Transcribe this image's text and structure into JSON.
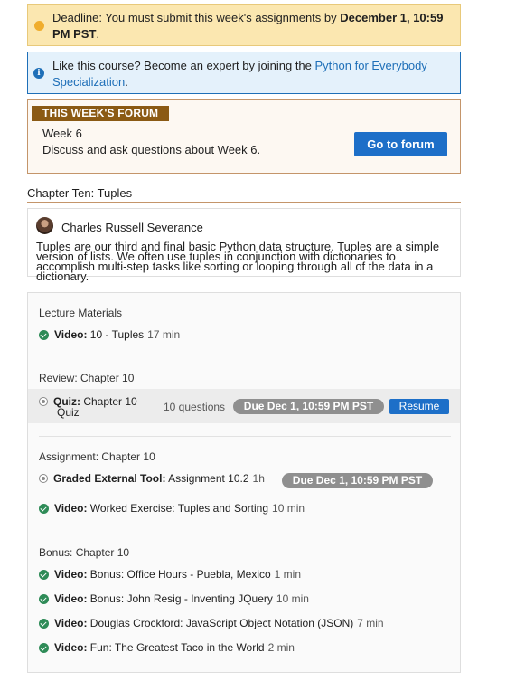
{
  "deadline": {
    "prefix": "Deadline: You must submit this week's assignments by ",
    "date": "December 1, 10:59 PM PST",
    "suffix": "."
  },
  "info": {
    "prefix": "Like this course? Become an expert by joining the ",
    "link": "Python for Everybody Specialization",
    "suffix": "."
  },
  "forum": {
    "label": "THIS WEEK'S FORUM",
    "week": "Week 6",
    "description": "Discuss and ask questions about Week 6.",
    "button": "Go to forum"
  },
  "chapter": {
    "title": "Chapter Ten: Tuples"
  },
  "instructor": {
    "name": "Charles Russell Severance",
    "description": "Tuples are our third and final basic Python data structure. Tuples are a simple version of lists. We often use tuples in conjunction with dictionaries to accomplish multi-step tasks like sorting or looping through all of the data in a dictionary."
  },
  "sections": {
    "lecture": "Lecture Materials",
    "review": "Review: Chapter 10",
    "assignment": "Assignment: Chapter 10",
    "bonus": "Bonus: Chapter 10"
  },
  "items": {
    "lecture_video": {
      "type": "Video:",
      "title": "10 - Tuples",
      "duration": "17 min"
    },
    "quiz": {
      "type": "Quiz:",
      "title_line1": "Chapter 10",
      "title_line2": "Quiz",
      "meta": "10 questions",
      "due": "Due Dec 1, 10:59 PM PST",
      "action": "Resume"
    },
    "tool": {
      "type": "Graded External Tool:",
      "title": "Assignment 10.2",
      "duration": "1h",
      "due": "Due Dec 1, 10:59 PM PST"
    },
    "worked": {
      "type": "Video:",
      "title": "Worked Exercise: Tuples and Sorting",
      "duration": "10 min"
    },
    "bonus1": {
      "type": "Video:",
      "title": "Bonus: Office Hours - Puebla, Mexico",
      "duration": "1 min"
    },
    "bonus2": {
      "type": "Video:",
      "title": "Bonus: John Resig - Inventing JQuery",
      "duration": "10 min"
    },
    "bonus3": {
      "type": "Video:",
      "title": "Douglas Crockford: JavaScript Object Notation (JSON)",
      "duration": "7 min"
    },
    "bonus4": {
      "type": "Video:",
      "title": "Fun: The Greatest Taco in the World",
      "duration": "2 min"
    }
  },
  "colors": {
    "accent": "#1d6fc8",
    "forum_label": "#8b5a14",
    "deadline_bg": "#fbe7b0",
    "completed": "#2e8b57",
    "due_badge": "#8f8f8f"
  }
}
